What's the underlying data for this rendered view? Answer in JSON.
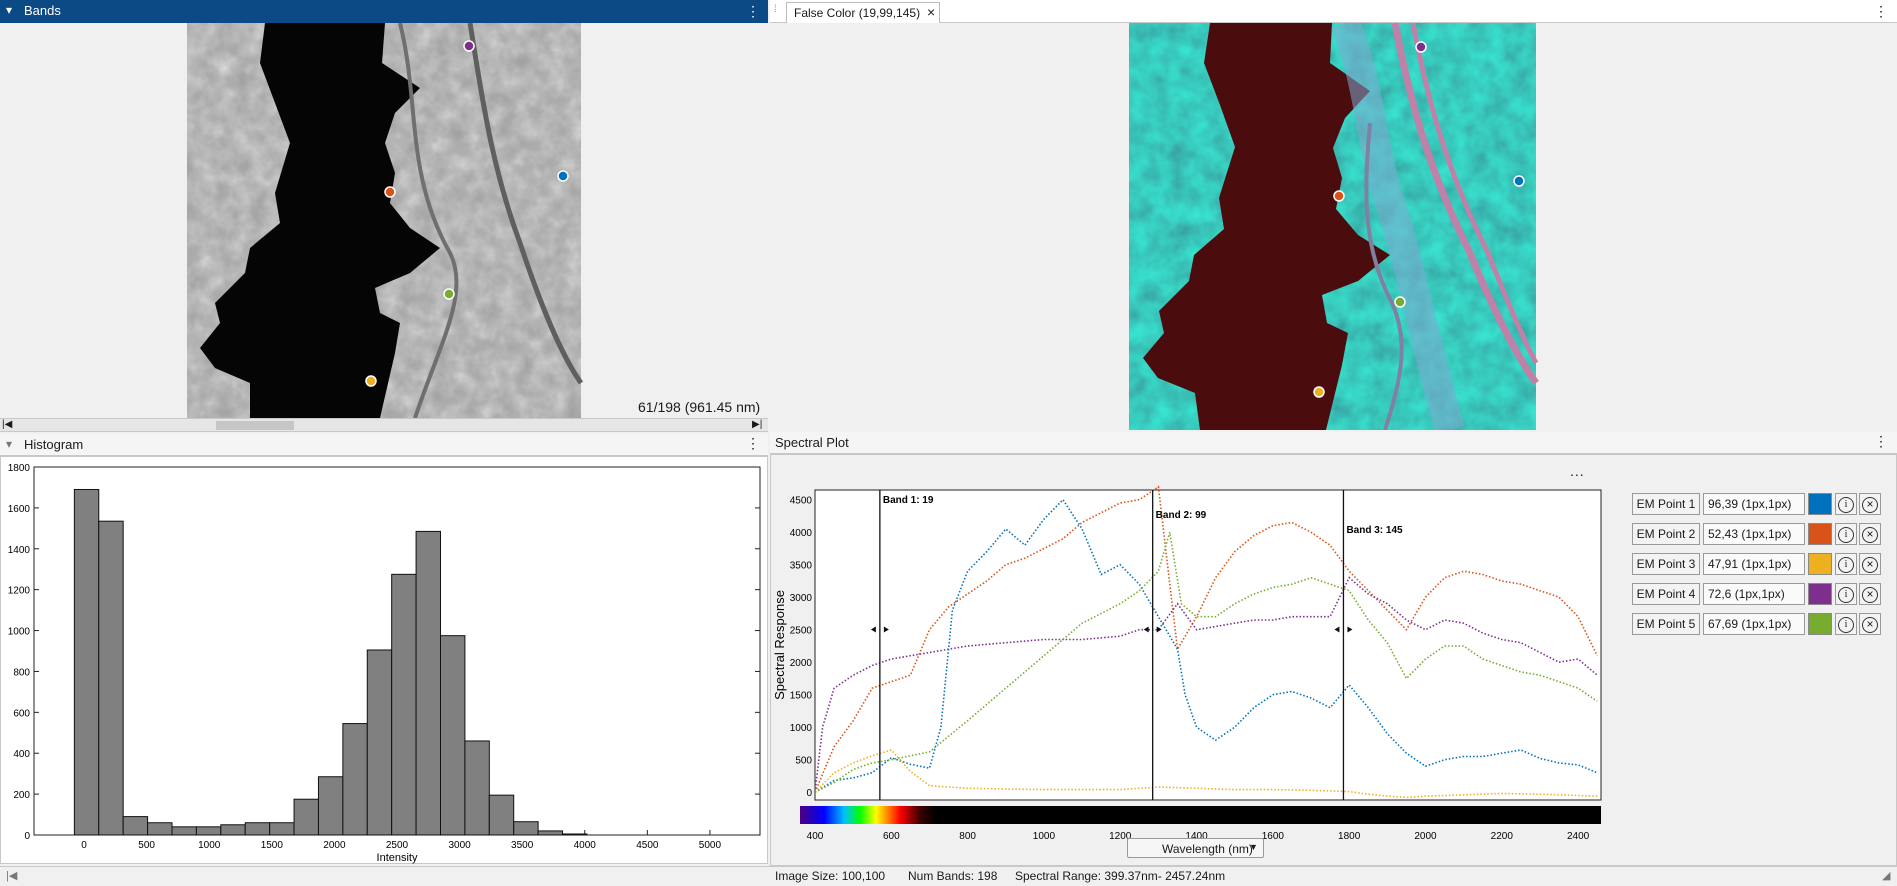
{
  "bands_panel": {
    "title": "Bands",
    "band_readout": "61/198 (961.45 nm)"
  },
  "false_color_tab": {
    "label": "False Color (19,99,145)",
    "close": "×"
  },
  "histogram": {
    "title": "Histogram",
    "chart_data": {
      "type": "bar",
      "xlabel": "Intensity",
      "ylabel": "",
      "xlim": [
        -400,
        5400
      ],
      "ylim": [
        0,
        1800
      ],
      "x_ticks": [
        0,
        500,
        1000,
        1500,
        2000,
        2500,
        3000,
        3500,
        4000,
        4500,
        5000
      ],
      "y_ticks": [
        0,
        200,
        400,
        600,
        800,
        1000,
        1200,
        1400,
        1600,
        1800
      ],
      "bin_width": 195,
      "bin_centers": [
        20,
        215,
        410,
        605,
        800,
        995,
        1190,
        1385,
        1580,
        1775,
        1970,
        2165,
        2360,
        2555,
        2750,
        2945,
        3140,
        3335,
        3530,
        3725,
        3920
      ],
      "values": [
        1690,
        1535,
        90,
        60,
        40,
        40,
        50,
        60,
        60,
        175,
        285,
        545,
        905,
        1275,
        1485,
        975,
        460,
        195,
        65,
        20,
        5
      ]
    }
  },
  "spectral_plot": {
    "title": "Spectral Plot",
    "more": "...",
    "chart_data": {
      "type": "line",
      "xlabel": "Wavelength (nm)",
      "ylabel": "Spectral Response",
      "xlim": [
        400,
        2460
      ],
      "ylim": [
        -120,
        4650
      ],
      "x_ticks": [
        400,
        600,
        800,
        1000,
        1200,
        1400,
        1600,
        1800,
        2000,
        2200,
        2400
      ],
      "y_ticks": [
        0,
        500,
        1000,
        1500,
        2000,
        2500,
        3000,
        3500,
        4000,
        4500
      ],
      "band_markers": [
        {
          "label": "Band 1: 19",
          "wavelength": 570
        },
        {
          "label": "Band 2: 99",
          "wavelength": 1285
        },
        {
          "label": "Band 3: 145",
          "wavelength": 1785
        }
      ],
      "series": [
        {
          "name": "EM Point 1",
          "color": "#0072bd",
          "x": [
            400,
            450,
            500,
            550,
            600,
            650,
            700,
            730,
            760,
            800,
            850,
            900,
            950,
            1000,
            1050,
            1100,
            1150,
            1200,
            1250,
            1300,
            1350,
            1370,
            1400,
            1450,
            1500,
            1550,
            1600,
            1650,
            1700,
            1750,
            1800,
            1850,
            1900,
            1950,
            2000,
            2050,
            2100,
            2150,
            2200,
            2250,
            2300,
            2350,
            2400,
            2450
          ],
          "y": [
            0,
            180,
            220,
            300,
            530,
            430,
            370,
            1000,
            2800,
            3400,
            3700,
            4050,
            3800,
            4200,
            4500,
            4050,
            3350,
            3500,
            3200,
            2700,
            2200,
            1500,
            1000,
            800,
            1000,
            1300,
            1500,
            1550,
            1450,
            1300,
            1650,
            1300,
            900,
            600,
            400,
            500,
            550,
            550,
            600,
            650,
            520,
            450,
            420,
            300
          ]
        },
        {
          "name": "EM Point 2",
          "color": "#d95319",
          "x": [
            400,
            450,
            500,
            550,
            600,
            650,
            700,
            750,
            800,
            850,
            900,
            950,
            1000,
            1050,
            1100,
            1150,
            1200,
            1250,
            1300,
            1330,
            1350,
            1400,
            1450,
            1500,
            1550,
            1600,
            1650,
            1700,
            1750,
            1800,
            1850,
            1900,
            1950,
            2000,
            2050,
            2100,
            2150,
            2200,
            2250,
            2300,
            2350,
            2400,
            2450
          ],
          "y": [
            0,
            700,
            1100,
            1600,
            1700,
            1800,
            2500,
            2850,
            3050,
            3250,
            3500,
            3600,
            3750,
            3900,
            4150,
            4300,
            4450,
            4500,
            4700,
            3200,
            2200,
            2700,
            3300,
            3700,
            3950,
            4100,
            4150,
            4000,
            3800,
            3400,
            3100,
            2800,
            2500,
            3000,
            3300,
            3400,
            3350,
            3250,
            3200,
            3100,
            3000,
            2700,
            2100
          ]
        },
        {
          "name": "EM Point 3",
          "color": "#edb120",
          "x": [
            400,
            450,
            500,
            550,
            600,
            650,
            700,
            800,
            900,
            1000,
            1100,
            1200,
            1300,
            1400,
            1500,
            1600,
            1700,
            1800,
            1850,
            1900,
            1950,
            2000,
            2100,
            2200,
            2300,
            2400,
            2450
          ],
          "y": [
            0,
            300,
            450,
            560,
            650,
            320,
            100,
            60,
            50,
            40,
            40,
            40,
            80,
            60,
            40,
            40,
            30,
            10,
            -30,
            -60,
            -80,
            -60,
            -40,
            -20,
            -30,
            -50,
            -60
          ]
        },
        {
          "name": "EM Point 4",
          "color": "#7e2f8e",
          "x": [
            400,
            420,
            450,
            500,
            550,
            600,
            650,
            700,
            750,
            800,
            900,
            1000,
            1100,
            1200,
            1250,
            1300,
            1350,
            1400,
            1450,
            1500,
            1550,
            1600,
            1650,
            1700,
            1750,
            1800,
            1850,
            1900,
            1950,
            2000,
            2050,
            2100,
            2150,
            2200,
            2250,
            2300,
            2350,
            2400,
            2450
          ],
          "y": [
            0,
            1000,
            1600,
            1800,
            1950,
            2050,
            2100,
            2150,
            2200,
            2250,
            2300,
            2350,
            2350,
            2400,
            2500,
            2500,
            2900,
            2500,
            2550,
            2600,
            2650,
            2650,
            2700,
            2700,
            2700,
            3300,
            3050,
            2900,
            2650,
            2500,
            2650,
            2600,
            2450,
            2350,
            2300,
            2150,
            2000,
            2050,
            1800
          ]
        },
        {
          "name": "EM Point 5",
          "color": "#77ac30",
          "x": [
            400,
            450,
            500,
            550,
            600,
            650,
            700,
            800,
            900,
            1000,
            1100,
            1200,
            1250,
            1300,
            1330,
            1360,
            1400,
            1450,
            1500,
            1550,
            1600,
            1650,
            1700,
            1750,
            1800,
            1850,
            1900,
            1950,
            2000,
            2050,
            2100,
            2150,
            2200,
            2250,
            2300,
            2350,
            2400,
            2450
          ],
          "y": [
            0,
            150,
            350,
            450,
            500,
            560,
            620,
            1100,
            1600,
            2100,
            2600,
            2900,
            3100,
            3400,
            4000,
            2900,
            2700,
            2700,
            2900,
            3050,
            3150,
            3200,
            3300,
            3200,
            3100,
            2650,
            2300,
            1750,
            2050,
            2250,
            2250,
            2050,
            1950,
            1850,
            1800,
            1700,
            1600,
            1400
          ]
        }
      ]
    }
  },
  "wavelength_dropdown": {
    "selected": "Wavelength (nm)",
    "arrow": "▼"
  },
  "em_points": [
    {
      "label": "EM Point 1",
      "value": "96,39 (1px,1px)",
      "color": "#0072bd"
    },
    {
      "label": "EM Point 2",
      "value": "52,43 (1px,1px)",
      "color": "#d95319"
    },
    {
      "label": "EM Point 3",
      "value": "47,91 (1px,1px)",
      "color": "#edb120"
    },
    {
      "label": "EM Point 4",
      "value": "72,6 (1px,1px)",
      "color": "#7e2f8e"
    },
    {
      "label": "EM Point 5",
      "value": "67,69 (1px,1px)",
      "color": "#77ac30"
    }
  ],
  "status_bar": {
    "image_size": "Image Size: 100,100",
    "num_bands": "Num Bands: 198",
    "spectral_range": "Spectral Range: 399.37nm- 2457.24nm"
  },
  "icons": {
    "kebab": "⋮",
    "collapse": "▾",
    "info": "i",
    "remove": "×"
  }
}
